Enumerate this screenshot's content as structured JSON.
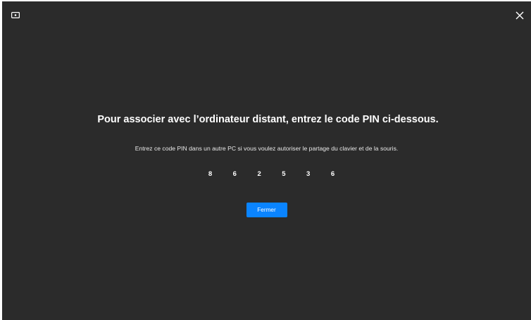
{
  "titlebar": {
    "app_icon": "monitor-icon",
    "close_icon": "close-icon"
  },
  "dialog": {
    "title": "Pour associer avec l’ordinateur distant, entrez le code PIN ci-dessous.",
    "description": "Entrez ce code PIN dans un autre PC si vous voulez autoriser le partage du clavier et de la souris.",
    "pin_digits": [
      "8",
      "6",
      "2",
      "5",
      "3",
      "6"
    ],
    "close_button_label": "Fermer"
  },
  "colors": {
    "background": "#2b2b2b",
    "button": "#0a84ff",
    "text": "#ffffff"
  }
}
